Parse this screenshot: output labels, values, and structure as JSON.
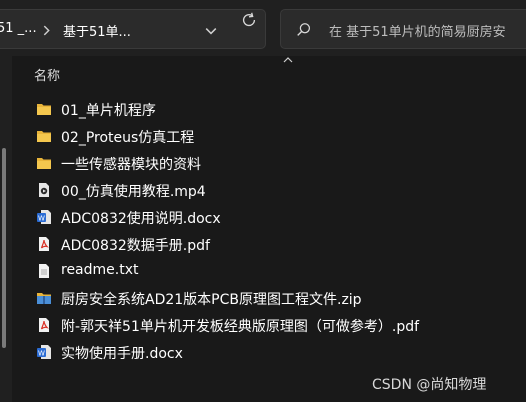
{
  "address_bar": {
    "crumbs": [
      "51 _...",
      "基于51单..."
    ]
  },
  "search": {
    "placeholder": "在 基于51单片机的简易厨房安"
  },
  "column_header": {
    "name": "名称"
  },
  "files": [
    {
      "name": "01_单片机程序",
      "icon": "folder-icon"
    },
    {
      "name": "02_Proteus仿真工程",
      "icon": "folder-icon"
    },
    {
      "name": "一些传感器模块的资料",
      "icon": "folder-icon"
    },
    {
      "name": "00_仿真使用教程.mp4",
      "icon": "video-file-icon"
    },
    {
      "name": "ADC0832使用说明.docx",
      "icon": "word-file-icon"
    },
    {
      "name": "ADC0832数据手册.pdf",
      "icon": "pdf-file-icon"
    },
    {
      "name": "readme.txt",
      "icon": "text-file-icon"
    },
    {
      "name": "厨房安全系统AD21版本PCB原理图工程文件.zip",
      "icon": "zip-file-icon"
    },
    {
      "name": "附-郭天祥51单片机开发板经典版原理图（可做参考）.pdf",
      "icon": "pdf-file-icon"
    },
    {
      "name": "实物使用手册.docx",
      "icon": "word-file-icon"
    }
  ],
  "watermark": "CSDN @尚知物理",
  "colors": {
    "background": "#191919",
    "folder": "#e8b43a",
    "pdf": "#d93025",
    "word": "#2b6cd4"
  }
}
